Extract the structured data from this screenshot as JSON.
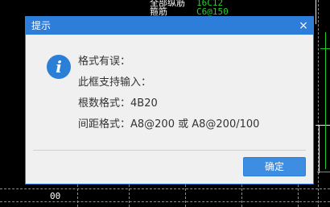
{
  "background": {
    "label_line_1": "全部纵筋",
    "value_line_1": "16C12",
    "label_line_2": "箍筋",
    "value_line_2": "C6@150",
    "bottom_text": "00"
  },
  "dialog": {
    "title": "提示",
    "close_glyph": "×",
    "icon": "info-icon",
    "lines": [
      "格式有误：",
      "此框支持输入：",
      "根数格式：4B20",
      "间距格式：A8@200 或 A8@200/100"
    ],
    "ok_label": "确定"
  },
  "colors": {
    "title_bar": "#2d7ddb",
    "button": "#3d8ee3",
    "dialog_bg": "#f0f0f0",
    "cad_green": "#22d12a"
  }
}
